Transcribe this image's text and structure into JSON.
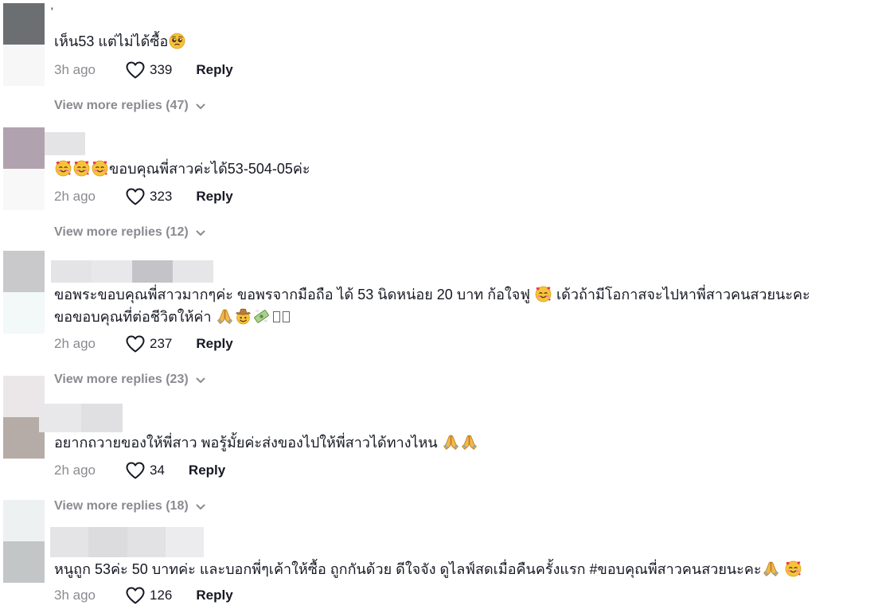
{
  "comments": [
    {
      "username": "'",
      "text_main": "เห็น53 แต่ไม่ได้ซื้อ",
      "emoji_after": "pleading-face",
      "time": "3h ago",
      "likes": "339",
      "reply_label": "Reply",
      "view_more": "View more replies (47)"
    },
    {
      "text_main": "ขอบคุณพี่สาวค่ะได้53-504-05ค่ะ",
      "emoji_before": [
        "smiling-face-with-hearts",
        "smiling-face-with-hearts",
        "smiling-face-with-hearts"
      ],
      "time": "2h ago",
      "likes": "323",
      "reply_label": "Reply",
      "view_more": "View more replies (12)"
    },
    {
      "text_line1_a": "ขอพระขอบคุณพี่สาวมากๆค่ะ ขอพรจากมือถือ ได้ 53 นิดหน่อย 20 บาท ก้อใจฟู",
      "text_line1_b": "เด้วถ้ามีโอกาสจะไปหาพี่สาวคนสวยนะคะ",
      "text_line2": "ขอขอบคุณที่ต่อชีวิตให้ค่า",
      "emojis": [
        "smiling-face-with-hearts",
        "folded-hands",
        "face-with-cowboy-hat",
        "money-with-wings"
      ],
      "time": "2h ago",
      "likes": "237",
      "reply_label": "Reply",
      "view_more": "View more replies (23)"
    },
    {
      "text_main": "อยากถวายของให้พี่สาว พอรู้มั้ยค่ะส่งของไปให้พี่สาวได้ทางไหน",
      "emojis": [
        "folded-hands",
        "folded-hands"
      ],
      "time": "2h ago",
      "likes": "34",
      "reply_label": "Reply",
      "view_more": "View more replies (18)"
    },
    {
      "text_main": "หนูถูก 53ค่ะ 50 บาทค่ะ และบอกพี่ๆเค้าให้ซื้อ ถูกกันด้วย ดีใจจัง ดูไลฟ์สดเมื่อคืนครั้งแรก #ขอบคุณพี่สาวคนสวยนะคะ",
      "emojis": [
        "folded-hands",
        "smiling-face-with-hearts"
      ],
      "time": "3h ago",
      "likes": "126",
      "reply_label": "Reply"
    }
  ],
  "icons": {
    "like": "heart-outline-icon",
    "expand": "chevron-down-icon"
  },
  "colors": {
    "muted": "#8a8b91",
    "text": "#161823"
  }
}
